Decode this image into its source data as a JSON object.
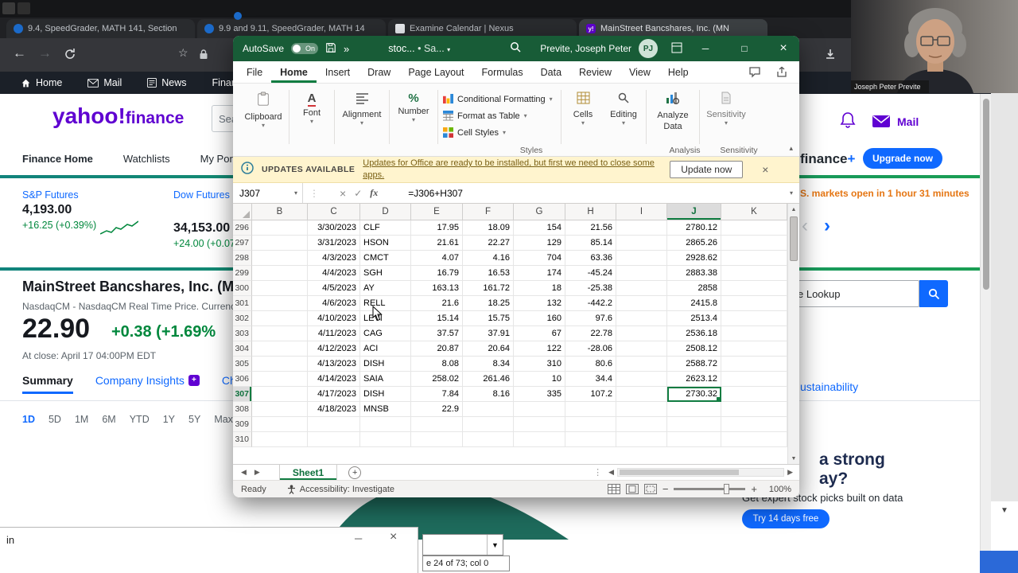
{
  "colors": {
    "excel_green": "#185C37",
    "excel_accent": "#107C41",
    "yahoo_purple": "#6001D2",
    "link_blue": "#0F69FF",
    "gain_green": "#00873C",
    "banner_yellow": "#FFF4CE"
  },
  "browser": {
    "tabs": [
      {
        "label": "9.4, SpeedGrader, MATH 141, Section",
        "icon": "course-icon",
        "active": false
      },
      {
        "label": "9.9 and 9.11, SpeedGrader, MATH 14",
        "icon": "course-icon",
        "active": false
      },
      {
        "label": "Examine Calendar | Nexus",
        "icon": "calendar-icon",
        "active": false
      },
      {
        "label": "MainStreet Bancshares, Inc. (MN",
        "icon": "yahoo-icon",
        "active": true
      }
    ],
    "find_text": "in",
    "combo_status": "e 24 of 73; col 0"
  },
  "yahoo": {
    "nav": [
      "Home",
      "Mail",
      "News",
      "Finance"
    ],
    "logo_main": "yahoo!",
    "logo_sub": "finance",
    "search_hint": "Sea",
    "subnav": [
      "Finance Home",
      "Watchlists",
      "My Portfolio"
    ],
    "futures": [
      {
        "label": "S&P Futures",
        "value": "4,193.00",
        "change": "+16.25 (+0.39%)"
      },
      {
        "label": "Dow Futures",
        "value": "34,153.00",
        "change": "+24.00 (+0.07"
      }
    ],
    "market_note": "S. markets open in 1 hour 31 minutes",
    "plus_brand": "finance",
    "plus_mark": "+",
    "upgrade_btn": "Upgrade now",
    "mail_label": "Mail",
    "lookup_value": "e Lookup",
    "sustain_link": "ustainability",
    "quote": {
      "title": "MainStreet Bancshares, Inc. (M",
      "subtitle": "NasdaqCM - NasdaqCM Real Time Price. Currenc",
      "price": "22.90",
      "change": "+0.38 (+1.69%",
      "at_close": "At close: April 17 04:00PM EDT",
      "tabs": [
        "Summary",
        "Company Insights",
        "Ch"
      ],
      "ranges": [
        "1D",
        "5D",
        "1M",
        "6M",
        "YTD",
        "1Y",
        "5Y",
        "Max"
      ]
    },
    "promo": {
      "line1": "a strong",
      "line2": "ay?",
      "sub": "Get expert stock picks built on data",
      "cta": "Try 14 days free"
    }
  },
  "excel": {
    "titlebar": {
      "autosave_label": "AutoSave",
      "autosave_state": "On",
      "more": "»",
      "doc_title": "stoc...",
      "doc_state": "• Sa...",
      "user_name": "Previte, Joseph Peter",
      "user_initials": "PJ"
    },
    "menu": [
      "File",
      "Home",
      "Insert",
      "Draw",
      "Page Layout",
      "Formulas",
      "Data",
      "Review",
      "View",
      "Help"
    ],
    "active_menu": "Home",
    "ribbon": {
      "big_groups": [
        "Clipboard",
        "Font",
        "Alignment",
        "Number"
      ],
      "styles_buttons": [
        "Conditional Formatting",
        "Format as Table",
        "Cell Styles"
      ],
      "styles_label": "Styles",
      "cells_group": "Cells",
      "editing_group": "Editing",
      "analyze_line1": "Analyze",
      "analyze_line2": "Data",
      "analysis_label": "Analysis",
      "sensitivity_group": "Sensitivity",
      "sensitivity_label": "Sensitivity"
    },
    "banner": {
      "badge": "UPDATES AVAILABLE",
      "message": "Updates for Office are ready to be installed, but first we need to close some apps.",
      "action": "Update now"
    },
    "formula": {
      "name_box": "J307",
      "fx": "fx",
      "expression": "=J306+H307"
    },
    "grid": {
      "columns": [
        "B",
        "C",
        "D",
        "E",
        "F",
        "G",
        "H",
        "I",
        "J",
        "K"
      ],
      "selected_column": "J",
      "selected_row": "307",
      "rows": [
        {
          "n": "296",
          "c": "3/30/2023",
          "d": "CLF",
          "e": "17.95",
          "f": "18.09",
          "g": "154",
          "h": "21.56",
          "j": "2780.12"
        },
        {
          "n": "297",
          "c": "3/31/2023",
          "d": "HSON",
          "e": "21.61",
          "f": "22.27",
          "g": "129",
          "h": "85.14",
          "j": "2865.26"
        },
        {
          "n": "298",
          "c": "4/3/2023",
          "d": "CMCT",
          "e": "4.07",
          "f": "4.16",
          "g": "704",
          "h": "63.36",
          "j": "2928.62"
        },
        {
          "n": "299",
          "c": "4/4/2023",
          "d": "SGH",
          "e": "16.79",
          "f": "16.53",
          "g": "174",
          "h": "-45.24",
          "j": "2883.38"
        },
        {
          "n": "300",
          "c": "4/5/2023",
          "d": "AY",
          "e": "163.13",
          "f": "161.72",
          "g": "18",
          "h": "-25.38",
          "j": "2858"
        },
        {
          "n": "301",
          "c": "4/6/2023",
          "d": "RELL",
          "e": "21.6",
          "f": "18.25",
          "g": "132",
          "h": "-442.2",
          "j": "2415.8"
        },
        {
          "n": "302",
          "c": "4/10/2023",
          "d": "LEVI",
          "e": "15.14",
          "f": "15.75",
          "g": "160",
          "h": "97.6",
          "j": "2513.4"
        },
        {
          "n": "303",
          "c": "4/11/2023",
          "d": "CAG",
          "e": "37.57",
          "f": "37.91",
          "g": "67",
          "h": "22.78",
          "j": "2536.18"
        },
        {
          "n": "304",
          "c": "4/12/2023",
          "d": "ACI",
          "e": "20.87",
          "f": "20.64",
          "g": "122",
          "h": "-28.06",
          "j": "2508.12"
        },
        {
          "n": "305",
          "c": "4/13/2023",
          "d": "DISH",
          "e": "8.08",
          "f": "8.34",
          "g": "310",
          "h": "80.6",
          "j": "2588.72"
        },
        {
          "n": "306",
          "c": "4/14/2023",
          "d": "SAIA",
          "e": "258.02",
          "f": "261.46",
          "g": "10",
          "h": "34.4",
          "j": "2623.12"
        },
        {
          "n": "307",
          "c": "4/17/2023",
          "d": "DISH",
          "e": "7.84",
          "f": "8.16",
          "g": "335",
          "h": "107.2",
          "j": "2730.32"
        },
        {
          "n": "308",
          "c": "4/18/2023",
          "d": "MNSB",
          "e": "22.9",
          "f": "",
          "g": "",
          "h": "",
          "j": ""
        },
        {
          "n": "309",
          "c": "",
          "d": "",
          "e": "",
          "f": "",
          "g": "",
          "h": "",
          "j": ""
        },
        {
          "n": "310",
          "c": "",
          "d": "",
          "e": "",
          "f": "",
          "g": "",
          "h": "",
          "j": ""
        }
      ]
    },
    "sheet": {
      "name": "Sheet1"
    },
    "status": {
      "mode": "Ready",
      "accessibility": "Accessibility: Investigate",
      "zoom": "100%"
    }
  },
  "webcam": {
    "name_label": "Joseph Peter Previte"
  }
}
